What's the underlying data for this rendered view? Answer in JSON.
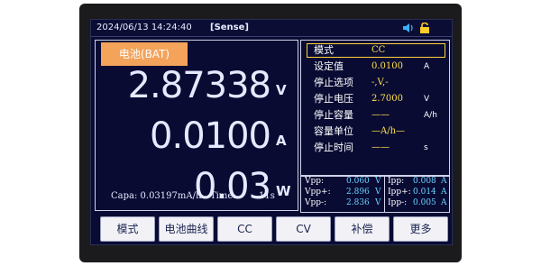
{
  "topbar": {
    "datetime": "2024/06/13 14:24:40",
    "sense": "[Sense]"
  },
  "status_icons": [
    "speaker-icon",
    "lock-icon"
  ],
  "main": {
    "tab_label": "电池(BAT)",
    "voltage": {
      "value": "2.87338",
      "unit": "V"
    },
    "current": {
      "value": "0.0100",
      "unit": "A"
    },
    "power": {
      "value": "0.03",
      "unit": "W"
    },
    "capa": "Capa: 0.03197mA/h",
    "time_label": "Time:",
    "time_value": "11s"
  },
  "settings": {
    "mode": {
      "label": "模式",
      "value": "CC"
    },
    "rows": [
      {
        "label": "设定值",
        "value": "0.0100",
        "unit": "A"
      },
      {
        "label": "停止选项",
        "value": "-,V,-",
        "unit": ""
      },
      {
        "label": "停止电压",
        "value": "2.7000",
        "unit": "V"
      },
      {
        "label": "停止容量",
        "value": "——",
        "unit": "A/h"
      },
      {
        "label": "容量单位",
        "value": "—A/h—",
        "unit": ""
      },
      {
        "label": "停止时间",
        "value": "——",
        "unit": "s"
      }
    ]
  },
  "measurements": {
    "left": [
      {
        "label": "Vpp:",
        "value": "0.060",
        "unit": "V"
      },
      {
        "label": "Vpp+:",
        "value": "2.896",
        "unit": "V"
      },
      {
        "label": "Vpp-:",
        "value": "2.836",
        "unit": "V"
      }
    ],
    "right": [
      {
        "label": "Ipp:",
        "value": "0.008",
        "unit": "A"
      },
      {
        "label": "Ipp+:",
        "value": "0.014",
        "unit": "A"
      },
      {
        "label": "Ipp-:",
        "value": "0.005",
        "unit": "A"
      }
    ]
  },
  "softkeys": [
    "模式",
    "电池曲线",
    "CC",
    "CV",
    "补偿",
    "更多"
  ],
  "colors": {
    "screen_bg": "#090b33",
    "tab": "#f4a35b",
    "accent": "#ffe04a",
    "meas": "#6bd3ff"
  }
}
